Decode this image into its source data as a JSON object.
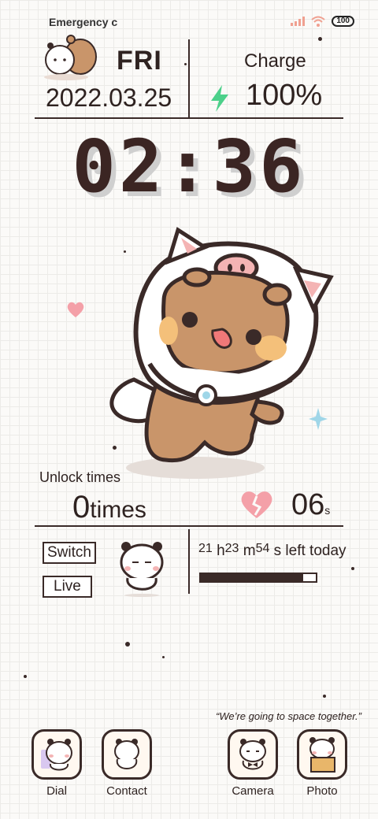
{
  "status_bar": {
    "carrier": "Emergency c",
    "battery": "100"
  },
  "header": {
    "day": "FRI",
    "date": "2022.03.25",
    "charge_label": "Charge",
    "charge_value": "100%"
  },
  "clock": {
    "time": "02:36"
  },
  "unlock": {
    "label": "Unlock times",
    "count": "0",
    "unit": "times",
    "seconds": "06",
    "seconds_suffix": "s"
  },
  "controls": {
    "switch_label": "Switch",
    "live_label": "Live"
  },
  "countdown": {
    "hours": "21",
    "h": "h",
    "minutes": "23",
    "m": "m",
    "secs": "54",
    "s_left": "s left today",
    "progress": 0.89
  },
  "quote": "“We’re going to space together.”",
  "dock": [
    {
      "label": "Dial"
    },
    {
      "label": "Contact"
    },
    {
      "label": "Camera"
    },
    {
      "label": "Photo"
    }
  ],
  "colors": {
    "ink": "#3a2a28",
    "bolt": "#4cd08a",
    "heart": "#f4a0a8",
    "sparkle": "#9fd6e8",
    "bear": "#c9956a"
  }
}
